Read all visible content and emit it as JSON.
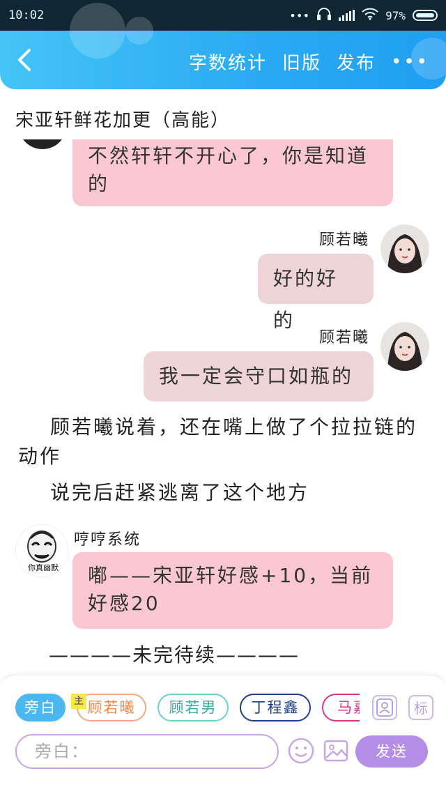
{
  "status_bar": {
    "time": "10:02",
    "battery": "97%",
    "dots": "•••"
  },
  "header": {
    "back_icon": "chevron-left-icon",
    "actions": [
      "字数统计",
      "旧版",
      "发布"
    ],
    "more": "•••"
  },
  "chapter": {
    "title": "宋亚轩鲜花加更（高能）"
  },
  "messages": [
    {
      "type": "bubble",
      "side": "left",
      "text": "不然轩轩不开心了，你是知道的"
    },
    {
      "type": "bubble",
      "side": "right",
      "name": "顾若曦",
      "text": "好的好的"
    },
    {
      "type": "bubble",
      "side": "right",
      "name": "顾若曦",
      "text": "我一定会守口如瓶的"
    },
    {
      "type": "narration",
      "text": "顾若曦说着，还在嘴上做了个拉拉链的动作"
    },
    {
      "type": "narration",
      "text": "说完后赶紧逃离了这个地方"
    },
    {
      "type": "bubble",
      "side": "left",
      "name": "哼哼系统",
      "avatar_caption": "你真幽默",
      "text": "嘟——宋亚轩好感+10，当前好感20"
    }
  ],
  "end_text": "————未完待续————",
  "composer": {
    "chips": [
      "旁白",
      "顾若曦",
      "顾若男",
      "丁程鑫",
      "马嘉"
    ],
    "tag_label": "主",
    "side_icons": [
      "person-icon",
      "标"
    ],
    "input_placeholder": "旁白：",
    "emoji_icon": "smiley-icon",
    "image_icon": "image-icon",
    "send_label": "发送"
  },
  "colors": {
    "header_blue": "#2aa9f3",
    "bubble_pink": "#fbc8d2",
    "bubble_gray": "#eed4d6",
    "accent_purple": "#b48de6",
    "chip_blue": "#4cb8f0"
  }
}
